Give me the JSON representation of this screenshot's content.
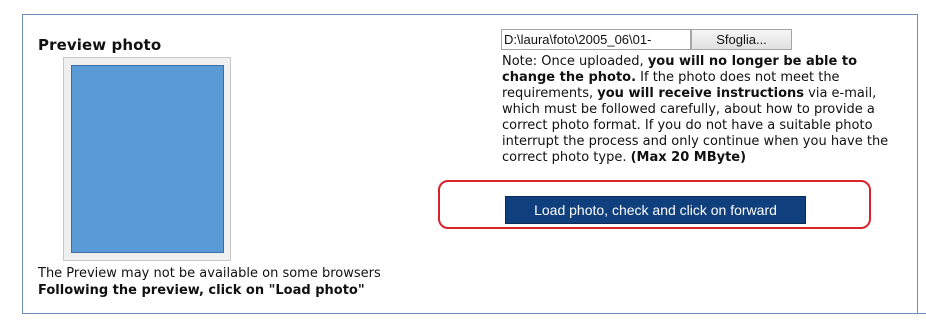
{
  "section": {
    "title": "Preview photo",
    "preview_note": "The Preview may not be available on some browsers",
    "preview_instruction": "Following the preview, click on \"Load photo\""
  },
  "upload": {
    "file_path_value": "D:\\laura\\foto\\2005_06\\01-",
    "browse_label": "Sfoglia..."
  },
  "note": {
    "intro": "Note: Once uploaded, ",
    "bold_1": "you will no longer be able to change the photo.",
    "text_2": " If the photo does not meet the requirements, ",
    "bold_2": "you will receive instructions",
    "text_3": " via e-mail, which must be followed carefully, about how to provide a correct photo format. If you do not have a suitable photo interrupt the process and only continue when you have the correct photo type. ",
    "bold_3": "(Max 20 MByte)"
  },
  "actions": {
    "load_label": "Load photo, check and click on forward"
  },
  "colors": {
    "panel_border": "#6f8fb8",
    "preview_fill": "#5b9bd5",
    "button_bg": "#0f3f7d",
    "highlight": "#d9232d"
  }
}
